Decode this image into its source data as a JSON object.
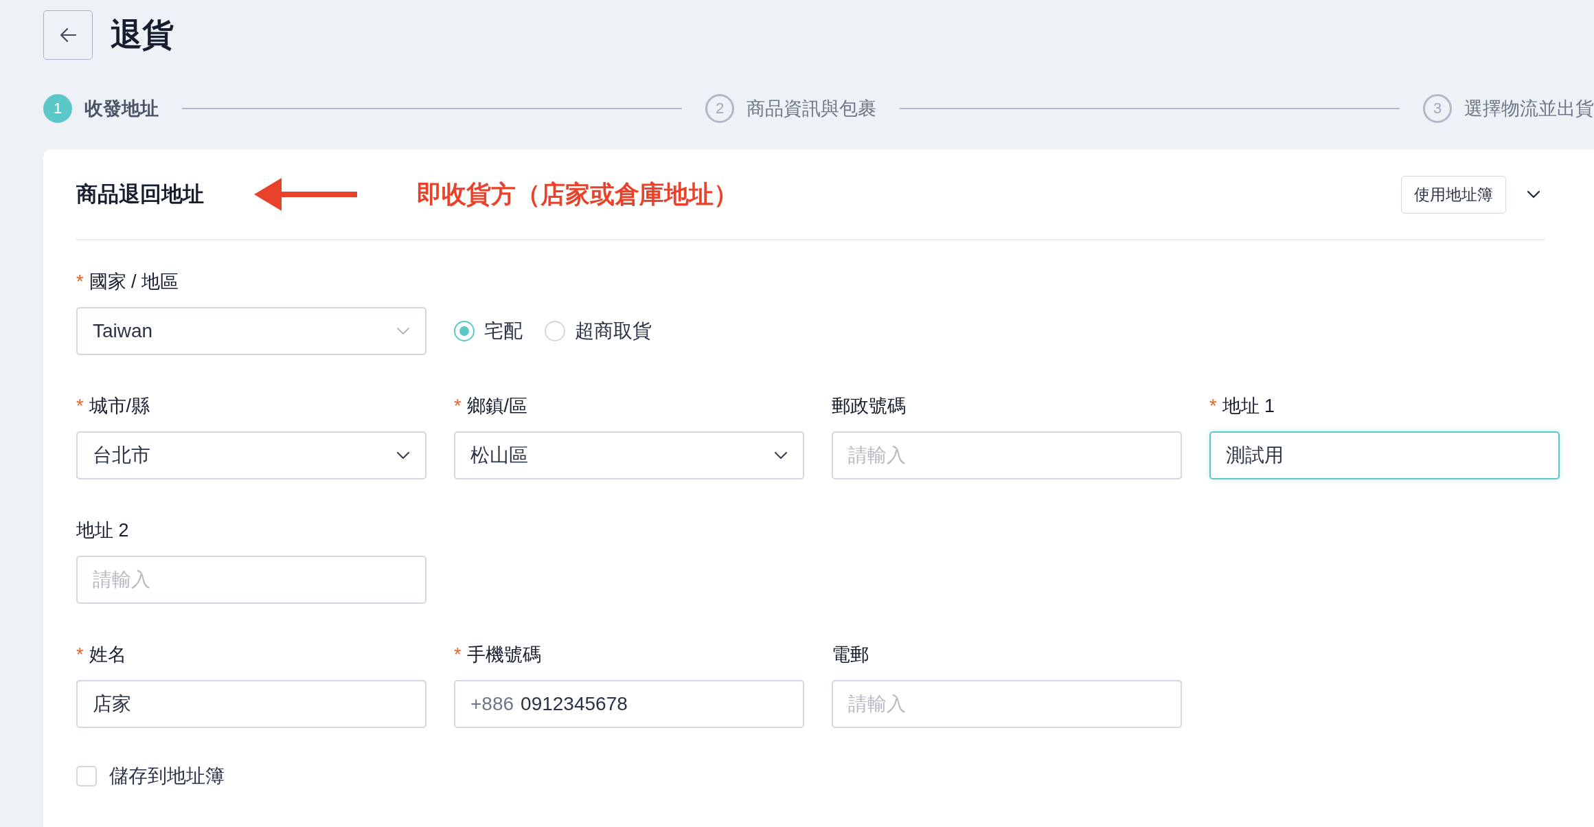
{
  "page": {
    "title": "退貨"
  },
  "steps": [
    {
      "number": "1",
      "label": "收發地址",
      "selected": true
    },
    {
      "number": "2",
      "label": "商品資訊與包裹",
      "selected": false
    },
    {
      "number": "3",
      "label": "選擇物流並出貨",
      "selected": false
    }
  ],
  "section": {
    "title": "商品退回地址",
    "annotation": "即收貨方（店家或倉庫地址）",
    "address_book_button": "使用地址簿"
  },
  "rows": [
    [
      {
        "kind": "select",
        "label": "國家 / 地區",
        "required_mark": "*",
        "value": "Taiwan",
        "light_chevron": true
      },
      {
        "kind": "radio_group",
        "options": [
          {
            "label": "宅配",
            "selected": true
          },
          {
            "label": "超商取貨",
            "selected": false
          }
        ]
      }
    ],
    [
      {
        "kind": "select",
        "label": "城市/縣",
        "required_mark": "*",
        "value": "台北市",
        "light_chevron": false
      },
      {
        "kind": "select",
        "label": "鄉鎮/區",
        "required_mark": "*",
        "value": "松山區",
        "light_chevron": false
      },
      {
        "kind": "input",
        "label": "郵政號碼",
        "placeholder": "請輸入",
        "focused": false
      },
      {
        "kind": "input",
        "label": "地址 1",
        "required_mark": "*",
        "value": "測試用",
        "focused": true
      }
    ],
    [
      {
        "kind": "input",
        "label": "地址 2",
        "placeholder": "請輸入",
        "focused": false
      }
    ],
    [
      {
        "kind": "input",
        "label": "姓名",
        "required_mark": "*",
        "value": "店家",
        "focused": false
      },
      {
        "kind": "phone",
        "label": "手機號碼",
        "required_mark": "*",
        "prefix": "+886",
        "value": "0912345678"
      },
      {
        "kind": "input",
        "label": "電郵",
        "placeholder": "請輸入",
        "focused": false
      }
    ]
  ],
  "save_to_address_book": {
    "label": "儲存到地址簿",
    "checked": false
  }
}
